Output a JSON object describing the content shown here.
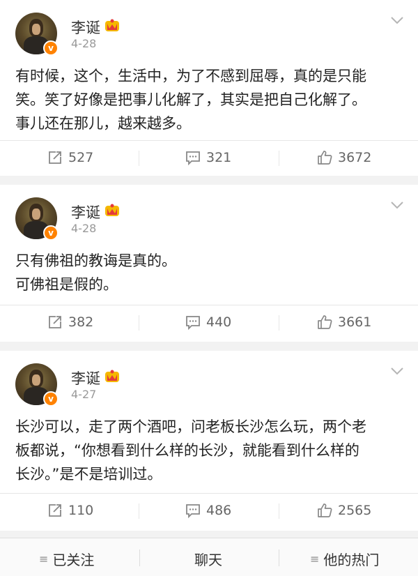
{
  "posts": [
    {
      "username": "李诞",
      "date": "4-28",
      "content_lines": [
        "有时候，这个，生活中，为了不感到屈辱，真的是只能",
        "笑。笑了好像是把事儿化解了，其实是把自己化解了。",
        "事儿还在那儿，越来越多。"
      ],
      "reposts": "527",
      "comments": "321",
      "likes": "3672"
    },
    {
      "username": "李诞",
      "date": "4-28",
      "content_lines": [
        "只有佛祖的教诲是真的。",
        "可佛祖是假的。"
      ],
      "reposts": "382",
      "comments": "440",
      "likes": "3661"
    },
    {
      "username": "李诞",
      "date": "4-27",
      "content_lines": [
        "长沙可以，走了两个酒吧，问老板长沙怎么玩，两个老",
        "板都说，“你想看到什么样的长沙，就能看到什么样的",
        "长沙。”是不是培训过。"
      ],
      "reposts": "110",
      "comments": "486",
      "likes": "2565"
    }
  ],
  "verified_badge": "v",
  "bottom_bar": {
    "followed_label": "已关注",
    "chat_label": "聊天",
    "hot_label": "他的热门",
    "menu_glyph": "≡"
  },
  "colors": {
    "badge_orange": "#ff8200",
    "crown_red": "#e4393c",
    "crown_gold": "#f5b800",
    "text_dark": "#222222",
    "text_gray": "#666666",
    "background": "#f2f2f2"
  },
  "icons": [
    "repost-icon",
    "comment-icon",
    "like-icon",
    "chevron-down-icon",
    "member-crown-icon",
    "menu-icon"
  ]
}
